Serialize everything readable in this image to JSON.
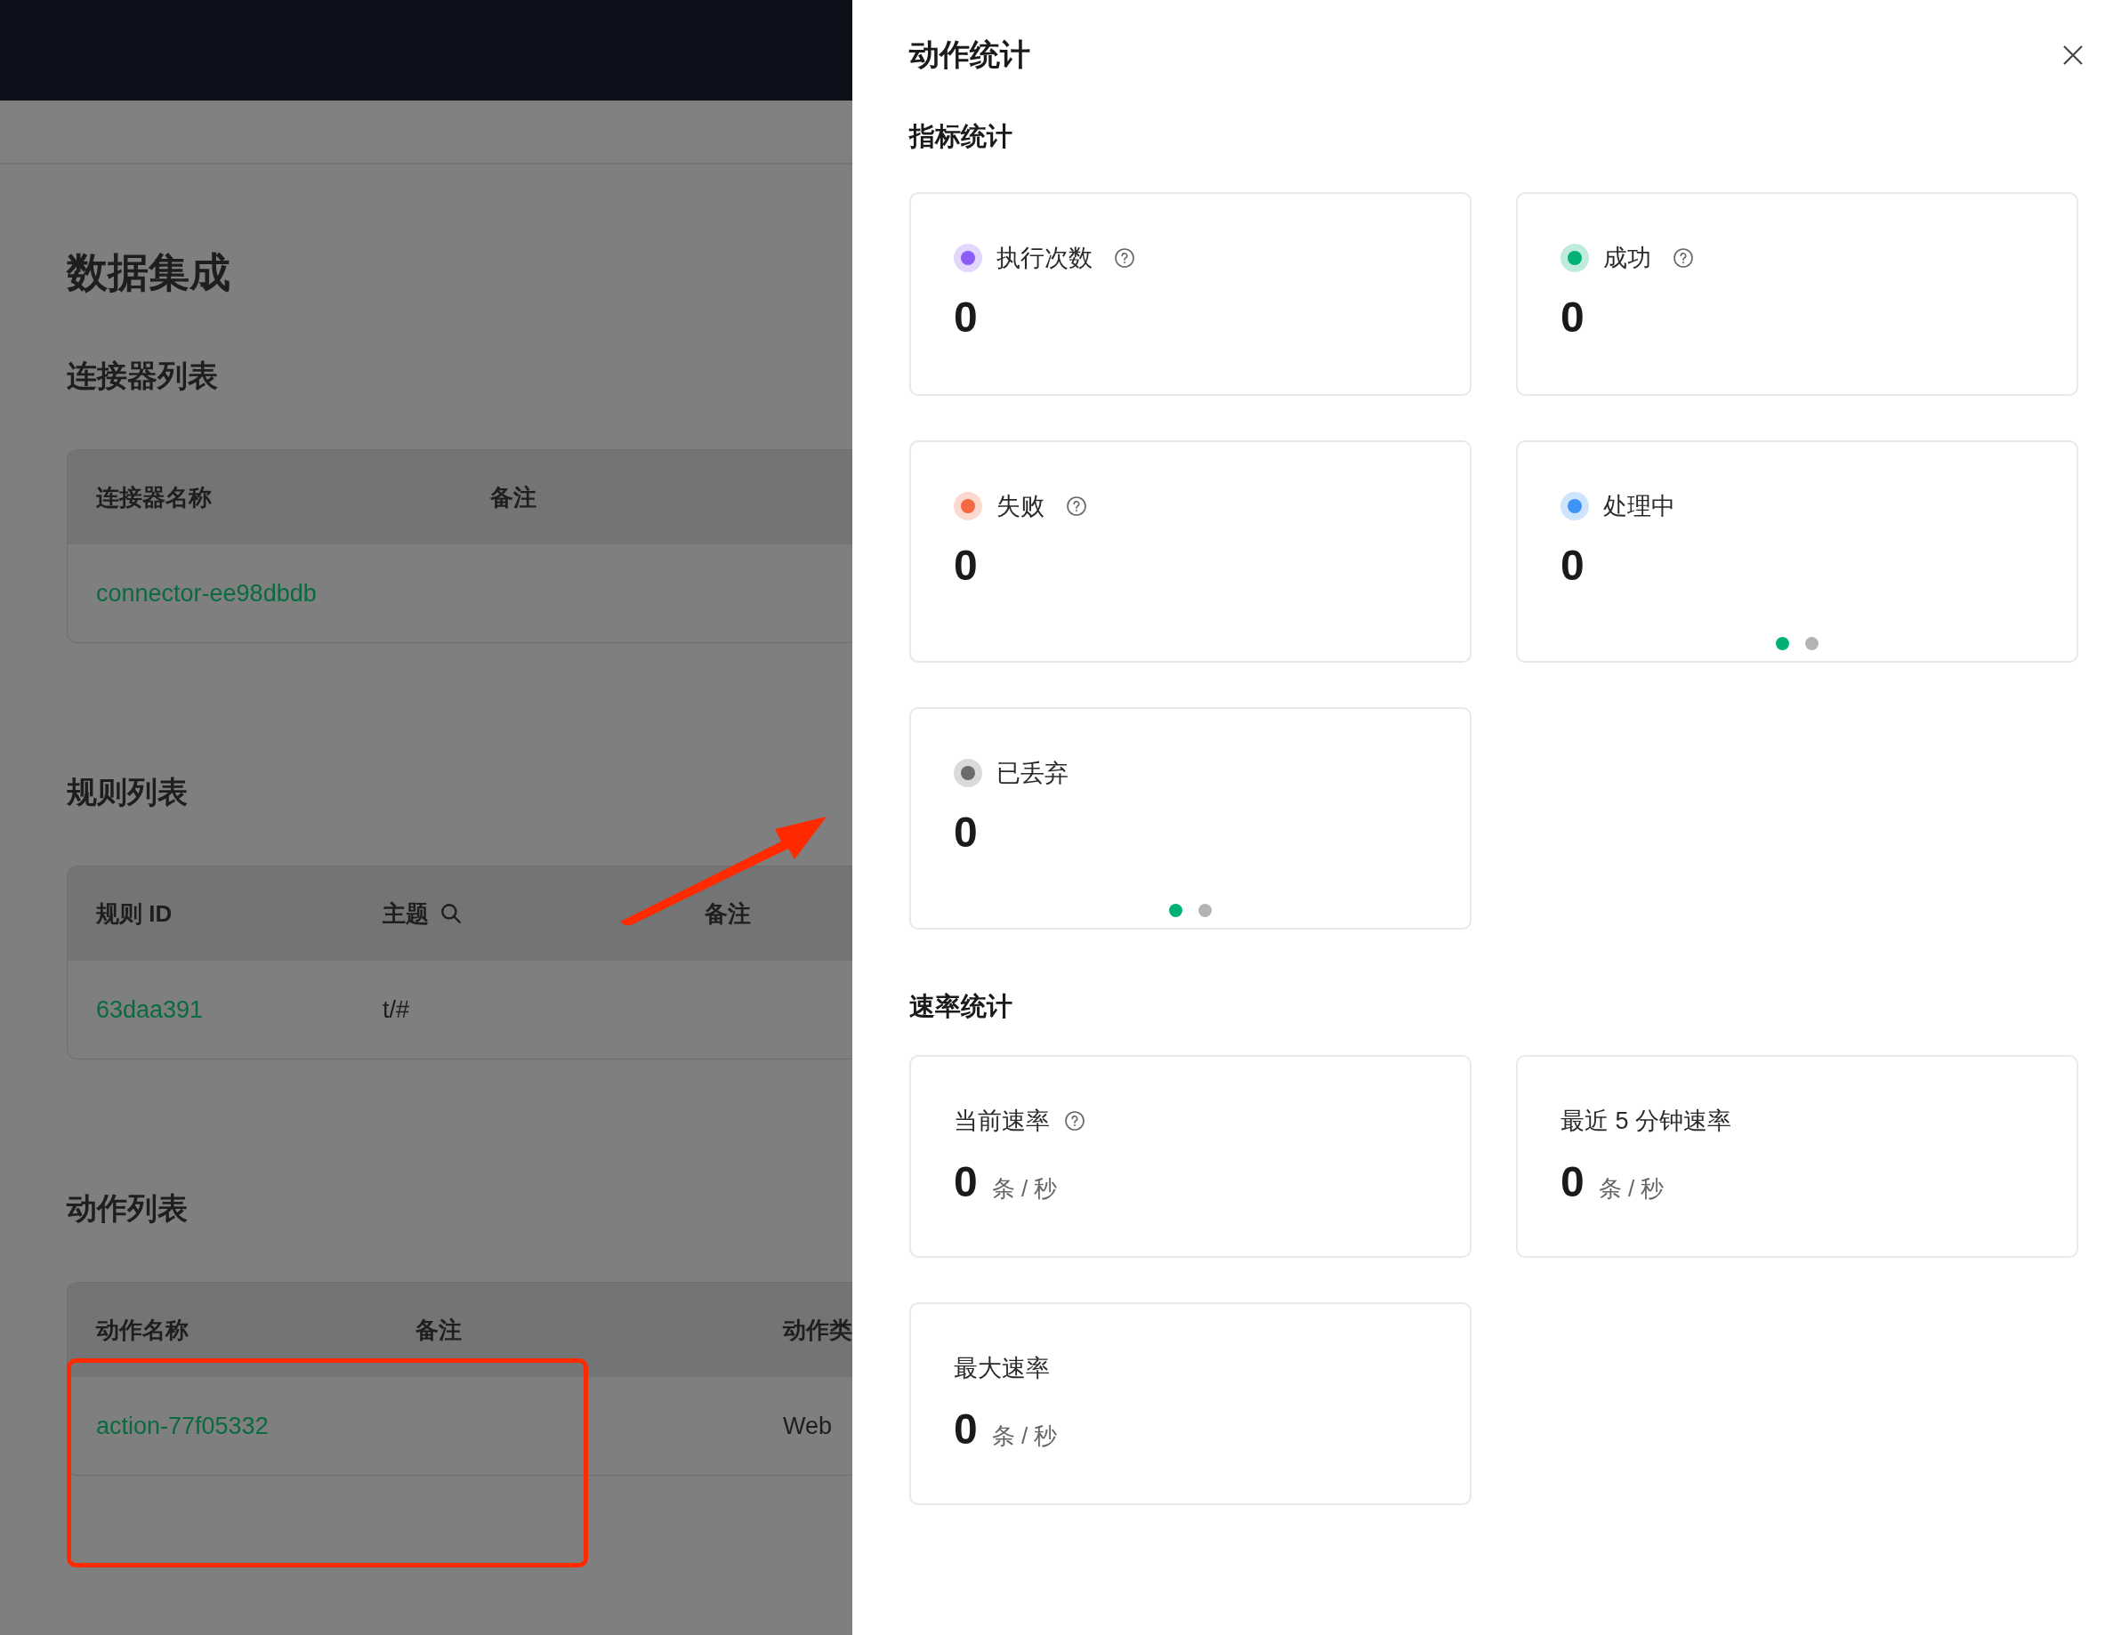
{
  "page": {
    "title": "数据集成",
    "sections": [
      {
        "heading": "连接器列表",
        "columns": [
          "连接器名称",
          "备注"
        ],
        "rows": [
          [
            "connector-ee98dbdb",
            ""
          ]
        ]
      },
      {
        "heading": "规则列表",
        "columns": [
          "规则 ID",
          "主题",
          "备注"
        ],
        "rows": [
          [
            "63daa391",
            "t/#",
            ""
          ]
        ]
      },
      {
        "heading": "动作列表",
        "columns": [
          "动作名称",
          "备注",
          "动作类"
        ],
        "rows": [
          [
            "action-77f05332",
            "",
            "Web"
          ]
        ]
      }
    ]
  },
  "drawer": {
    "title": "动作统计",
    "metrics_heading": "指标统计",
    "metrics": [
      {
        "label": "执行次数",
        "value": "0",
        "color": "#8b5cf6",
        "help": true
      },
      {
        "label": "成功",
        "value": "0",
        "color": "#00b173",
        "help": true
      },
      {
        "label": "失败",
        "value": "0",
        "color": "#f4693f",
        "help": true
      },
      {
        "label": "处理中",
        "value": "0",
        "color": "#3b94f6",
        "help": false,
        "pager": [
          {
            "selected": true
          },
          {
            "selected": false
          }
        ]
      },
      {
        "label": "已丢弃",
        "value": "0",
        "color": "#6b6b6b",
        "help": false,
        "pager": [
          {
            "selected": true
          },
          {
            "selected": false
          }
        ]
      }
    ],
    "rates_heading": "速率统计",
    "rates": [
      {
        "label": "当前速率",
        "value": "0",
        "unit": "条 / 秒",
        "help": true
      },
      {
        "label": "最近 5 分钟速率",
        "value": "0",
        "unit": "条 / 秒",
        "help": false
      },
      {
        "label": "最大速率",
        "value": "0",
        "unit": "条 / 秒",
        "help": false
      }
    ]
  }
}
